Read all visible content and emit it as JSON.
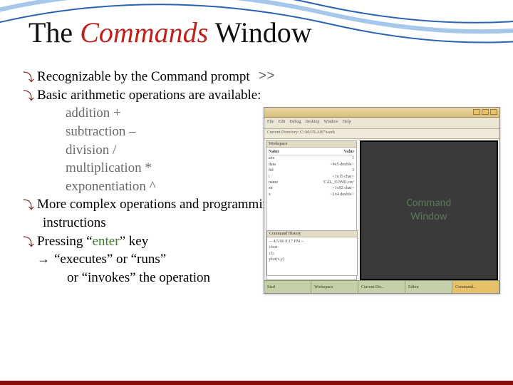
{
  "title": {
    "t1": "The",
    "t2": "Commands",
    "t3": "Window"
  },
  "bullets": {
    "b1_pre": "Recognizable by the Command prompt",
    "prompt": ">>",
    "b2": "Basic arithmetic operations are available:",
    "ops": {
      "add": "addition +",
      "sub": "subtraction –",
      "div": "division /",
      "mul": "multiplication *",
      "exp": "exponentiation ^"
    },
    "b3_l1": "More complex operations and programming",
    "b3_l2": "instructions",
    "b4_pre": "Pressing “",
    "b4_enter": "enter",
    "b4_post": "” key",
    "b4_res1": "“executes” or “runs”",
    "b4_res2": "or “invokes”   the operation"
  },
  "shot": {
    "menus": [
      "File",
      "Edit",
      "Debug",
      "Desktop",
      "Window",
      "Help"
    ],
    "path": "Current Directory:  C:\\MATLAB7\\work",
    "workspace_head": "Workspace",
    "workspace_cols": {
      "c1": "Name",
      "c2": "Value"
    },
    "workspace_rows": [
      {
        "n": "ans",
        "v": "1"
      },
      {
        "n": "data",
        "v": "<4x5 double>"
      },
      {
        "n": "fid",
        "v": "3"
      },
      {
        "n": "i",
        "v": "<1x15 char>"
      },
      {
        "n": "name",
        "v": "'CAL_COND.csv'"
      },
      {
        "n": "str",
        "v": "<1x92 char>"
      },
      {
        "n": "x",
        "v": "<1x4 double>"
      }
    ],
    "history_head": "Command History",
    "history_lines": [
      "-- 4/5/06  8:17 PM --",
      "clear",
      "clc",
      "plot(x,y)"
    ],
    "cmdwin_label_l1": "Command",
    "cmdwin_label_l2": "Window",
    "tabs": [
      "Start",
      "Workspace",
      "Current Dir...",
      "Editor",
      "Command..."
    ]
  }
}
